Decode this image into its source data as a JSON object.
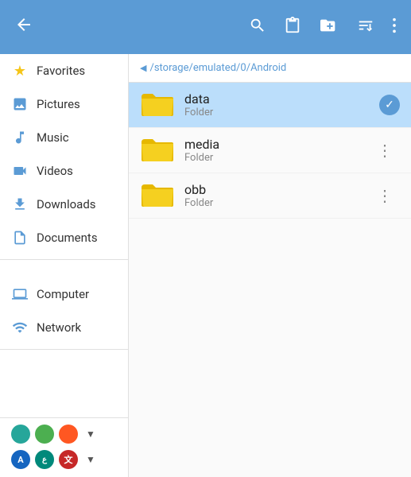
{
  "topbar": {
    "back_label": "←",
    "search_label": "search",
    "clipboard_label": "clipboard",
    "newfolder_label": "new folder",
    "sort_label": "sort",
    "more_label": "more options"
  },
  "breadcrumb": {
    "arrow": "◀",
    "path": "/storage/emulated/0/Android"
  },
  "sidebar": {
    "items": [
      {
        "id": "favorites",
        "label": "Favorites",
        "icon": "star"
      },
      {
        "id": "pictures",
        "label": "Pictures",
        "icon": "pictures"
      },
      {
        "id": "music",
        "label": "Music",
        "icon": "music"
      },
      {
        "id": "videos",
        "label": "Videos",
        "icon": "videos"
      },
      {
        "id": "downloads",
        "label": "Downloads",
        "icon": "downloads"
      },
      {
        "id": "documents",
        "label": "Documents",
        "icon": "documents"
      }
    ],
    "bottom_items": [
      {
        "id": "computer",
        "label": "Computer",
        "icon": "computer"
      },
      {
        "id": "network",
        "label": "Network",
        "icon": "network"
      }
    ],
    "dots": [
      {
        "id": "teal",
        "color": "#26a69a"
      },
      {
        "id": "green",
        "color": "#4caf50"
      },
      {
        "id": "orange",
        "color": "#ff5722"
      }
    ],
    "lang_badges": [
      {
        "id": "en",
        "label": "A",
        "color": "#1565c0"
      },
      {
        "id": "ar",
        "label": "ع",
        "color": "#00897b"
      },
      {
        "id": "zh",
        "label": "文",
        "color": "#c62828"
      }
    ]
  },
  "files": [
    {
      "id": "data",
      "name": "data",
      "type": "Folder",
      "selected": true
    },
    {
      "id": "media",
      "name": "media",
      "type": "Folder",
      "selected": false
    },
    {
      "id": "obb",
      "name": "obb",
      "type": "Folder",
      "selected": false
    }
  ]
}
